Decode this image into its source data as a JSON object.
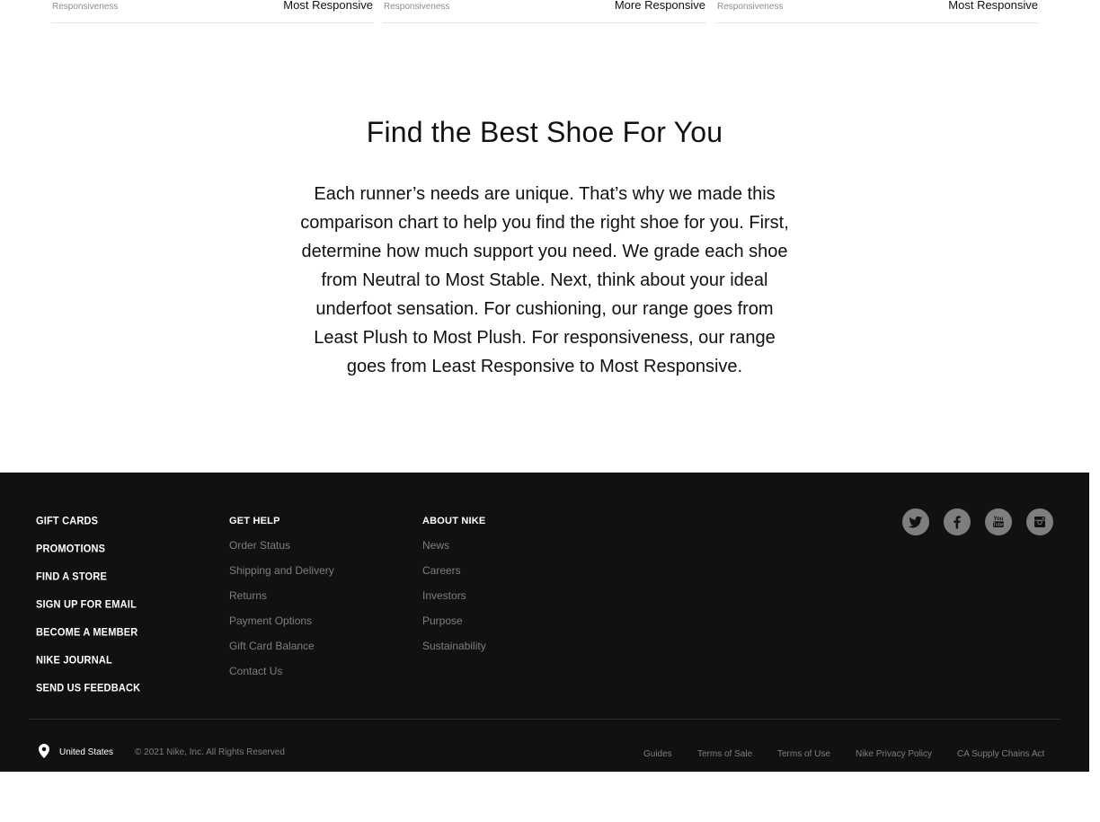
{
  "comparison_strip": [
    {
      "label_small": "Responsiveness",
      "label_big": "Most Responsive"
    },
    {
      "label_small": "Responsiveness",
      "label_big": "More Responsive"
    },
    {
      "label_small": "Responsiveness",
      "label_big": "Most Responsive"
    }
  ],
  "intro": {
    "title": "Find the Best Shoe For You",
    "body": "Each runner’s needs are unique. That’s why we made this comparison chart to help you find the right shoe for you. First, determine how much support you need. We grade each shoe from Neutral to Most Stable. Next, think about your ideal underfoot sensation. For cushioning, our range goes from Least Plush to Most Plush. For responsiveness, our range goes from Least Responsive to Most Responsive."
  },
  "footer": {
    "primary_links": [
      "Gift Cards",
      "Promotions",
      "Find a Store",
      "Sign Up for Email",
      "Become a Member",
      "Nike Journal",
      "Send Us Feedback"
    ],
    "get_help": {
      "heading": "Get Help",
      "links": [
        "Order Status",
        "Shipping and Delivery",
        "Returns",
        "Payment Options",
        "Gift Card Balance",
        "Contact Us"
      ]
    },
    "about": {
      "heading": "About Nike",
      "links": [
        "News",
        "Careers",
        "Investors",
        "Purpose",
        "Sustainability"
      ]
    },
    "social_icons": [
      "twitter-icon",
      "facebook-icon",
      "youtube-icon",
      "instagram-icon"
    ],
    "location": "United States",
    "copyright": "© 2021 Nike, Inc. All Rights Reserved",
    "legal_links": [
      "Guides",
      "Terms of Sale",
      "Terms of Use",
      "Nike Privacy Policy",
      "CA Supply Chains Act"
    ],
    "colors": {
      "background": "#111111",
      "muted_text": "#7e7e7e",
      "primary_text": "#ffffff"
    }
  }
}
